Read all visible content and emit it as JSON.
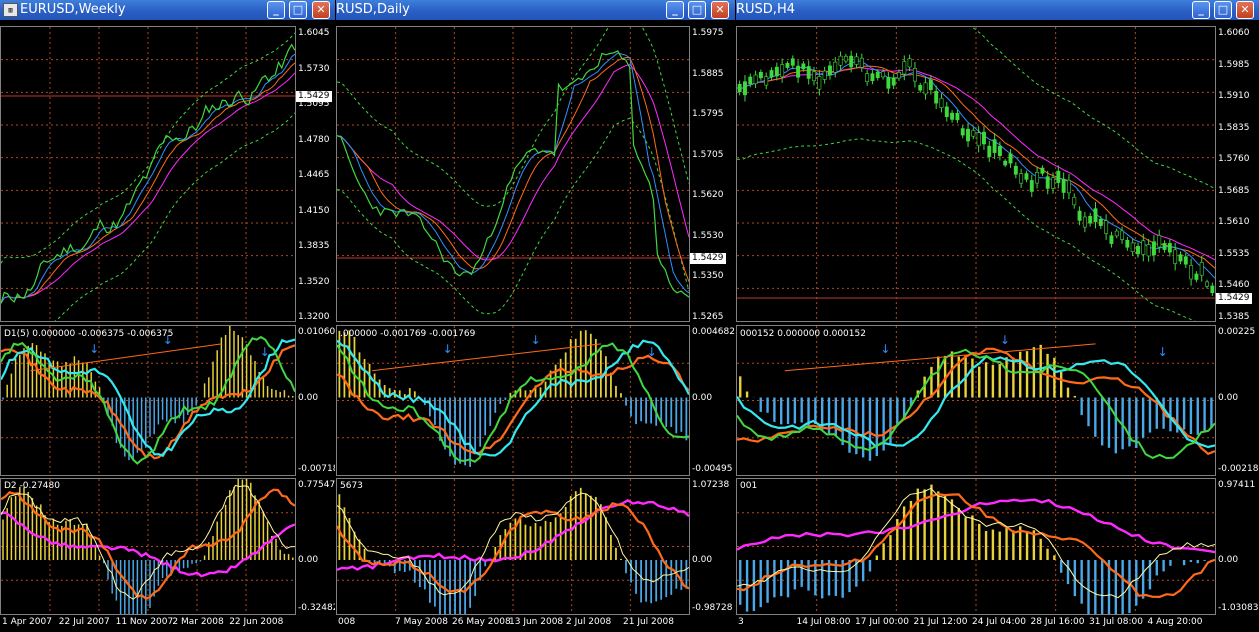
{
  "windows": [
    {
      "title": "EURUSD,Weekly",
      "price_scale": [
        "1.6045",
        "1.5730",
        "1.5095",
        "1.4780",
        "1.4465",
        "1.4150",
        "1.3835",
        "1.3520",
        "1.3200"
      ],
      "current_price": "1.5429",
      "ind1_label": "D1(5) 0.000000 -0.006375 -0.006375",
      "ind1_scale": [
        "0.010604",
        "0.00",
        "-0.00718"
      ],
      "ind2_label": "D2 -0.27480",
      "ind2_scale": [
        "0.77547",
        "0.00",
        "-0.32482"
      ],
      "x_labels": [
        "1 Apr 2007",
        "22 Jul 2007",
        "11 Nov 2007",
        "2 Mar 2008",
        "22 Jun 2008"
      ]
    },
    {
      "title": "RUSD,Daily",
      "price_scale": [
        "1.5975",
        "1.5885",
        "1.5795",
        "1.5705",
        "1.5620",
        "1.5530",
        "1.5350",
        "1.5265"
      ],
      "current_price": "1.5429",
      "ind1_label": ".000000 -0.001769 -0.001769",
      "ind1_scale": [
        "0.004682",
        "0.00",
        "-0.00495"
      ],
      "ind2_label": "5673",
      "ind2_scale": [
        "1.07238",
        "0.00",
        "-0.98728"
      ],
      "x_labels": [
        "008",
        "7 May 2008",
        "26 May 2008",
        "13 Jun 2008",
        "2 Jul 2008",
        "21 Jul 2008"
      ]
    },
    {
      "title": "RUSD,H4",
      "price_scale": [
        "1.6060",
        "1.5985",
        "1.5910",
        "1.5835",
        "1.5760",
        "1.5685",
        "1.5610",
        "1.5535",
        "1.5460",
        "1.5385"
      ],
      "current_price": "1.5429",
      "ind1_label": "000152 0.000000 0.000152",
      "ind1_scale": [
        "0.00225",
        "0.00",
        "-0.00218"
      ],
      "ind2_label": "001",
      "ind2_scale": [
        "0.97411",
        "0.00",
        "-1.03083"
      ],
      "x_labels": [
        "3",
        "14 Jul 08:00",
        "17 Jul 00:00",
        "21 Jul 12:00",
        "24 Jul 04:00",
        "28 Jul 16:00",
        "31 Jul 08:00",
        "4 Aug 20:00"
      ]
    }
  ],
  "buttons": {
    "minimize": "_",
    "maximize": "□",
    "close": "✕"
  },
  "colors": {
    "green": "#3fd83f",
    "blue": "#2f8fff",
    "orange": "#ff6a1a",
    "magenta": "#ff2aff",
    "yellow": "#e8d23a",
    "cyan": "#34e8f0",
    "hist_blue": "#4aa8e8",
    "grid": "#b54a1a",
    "price_line": "#c0392b"
  }
}
